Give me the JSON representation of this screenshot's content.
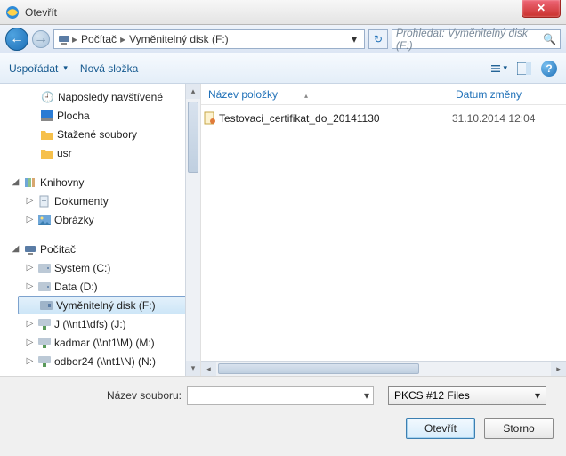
{
  "window": {
    "title": "Otevřít"
  },
  "nav": {
    "breadcrumb": [
      "Počítač",
      "Vyměnitelný disk (F:)"
    ],
    "search_placeholder": "Prohledat: Vyměnitelný disk (F:)"
  },
  "toolbar": {
    "organize": "Uspořádat",
    "new_folder": "Nová složka"
  },
  "tree": {
    "recent": "Naposledy navštívené",
    "desktop": "Plocha",
    "downloads": "Stažené soubory",
    "usr": "usr",
    "libraries": "Knihovny",
    "documents": "Dokumenty",
    "pictures": "Obrázky",
    "computer": "Počítač",
    "system_c": "System (C:)",
    "data_d": "Data (D:)",
    "removable_f": "Vyměnitelný disk (F:)",
    "net_j": "J (\\\\nt1\\dfs) (J:)",
    "net_m": "kadmar (\\\\nt1\\M) (M:)",
    "net_n": "odbor24 (\\\\nt1\\N) (N:)"
  },
  "filelist": {
    "col_name": "Název položky",
    "col_date": "Datum změny",
    "rows": [
      {
        "name": "Testovaci_certifikat_do_20141130",
        "date": "31.10.2014 12:04"
      }
    ]
  },
  "bottom": {
    "filename_label": "Název souboru:",
    "filter": "PKCS #12 Files",
    "open": "Otevřít",
    "cancel": "Storno"
  }
}
